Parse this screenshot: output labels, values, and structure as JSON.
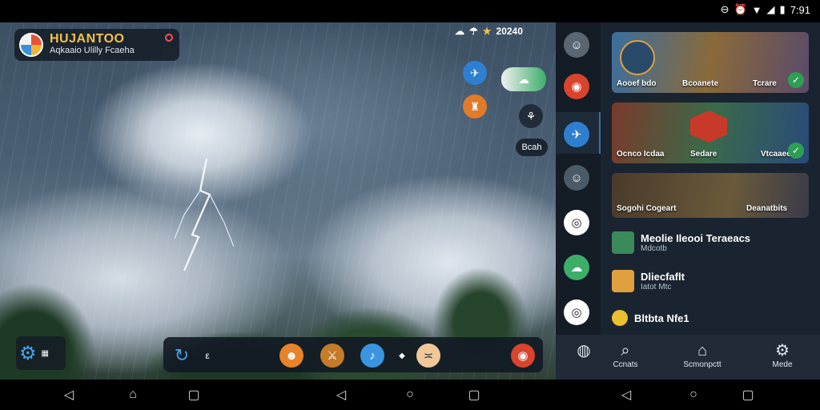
{
  "status": {
    "time": "7:91",
    "icons": [
      "do-not-disturb-icon",
      "alarm-icon",
      "wifi-icon",
      "signal-icon",
      "battery-icon"
    ]
  },
  "header": {
    "app_title": "HUJANTOO",
    "app_subtitle": "Aqkaaio Ulilly Fcaeha"
  },
  "weather": {
    "temp": "20240"
  },
  "pills": {
    "label": "Bcah"
  },
  "dock": {
    "items": [
      "refresh-icon",
      "chat-icon",
      "game1-icon",
      "game2-icon",
      "twitter-icon",
      "diamond-icon",
      "face-icon",
      "basketball-icon"
    ],
    "dock_text": "ε"
  },
  "panel": {
    "cards": [
      {
        "label_left": "Aooef bdo",
        "label_mid": "Bcoanete",
        "label_right": "Tcrare"
      },
      {
        "label_left": "Ocnco Icdaa",
        "label_mid": "Sedare",
        "label_right": "Vtcaaee"
      },
      {
        "label_left": "Sogohi Cogeart",
        "label_right": "Deanatbits"
      }
    ],
    "list": [
      {
        "title": "Meolie Ileooi Teraeacs",
        "sub": "Mdcotb"
      },
      {
        "title": "Dliecfaflt",
        "sub": "Iatot Mtc"
      },
      {
        "title": "Bltbta Nfe1",
        "sub": ""
      }
    ]
  },
  "bottomnav": {
    "items": [
      {
        "label": "Ccnats"
      },
      {
        "label": "Scmonpctt"
      },
      {
        "label": "Mede"
      }
    ]
  },
  "colors": {
    "accent": "#f2c14e",
    "panel_bg": "#1a2430",
    "sidebar_bg": "#141c26",
    "check": "#2f9e55"
  }
}
